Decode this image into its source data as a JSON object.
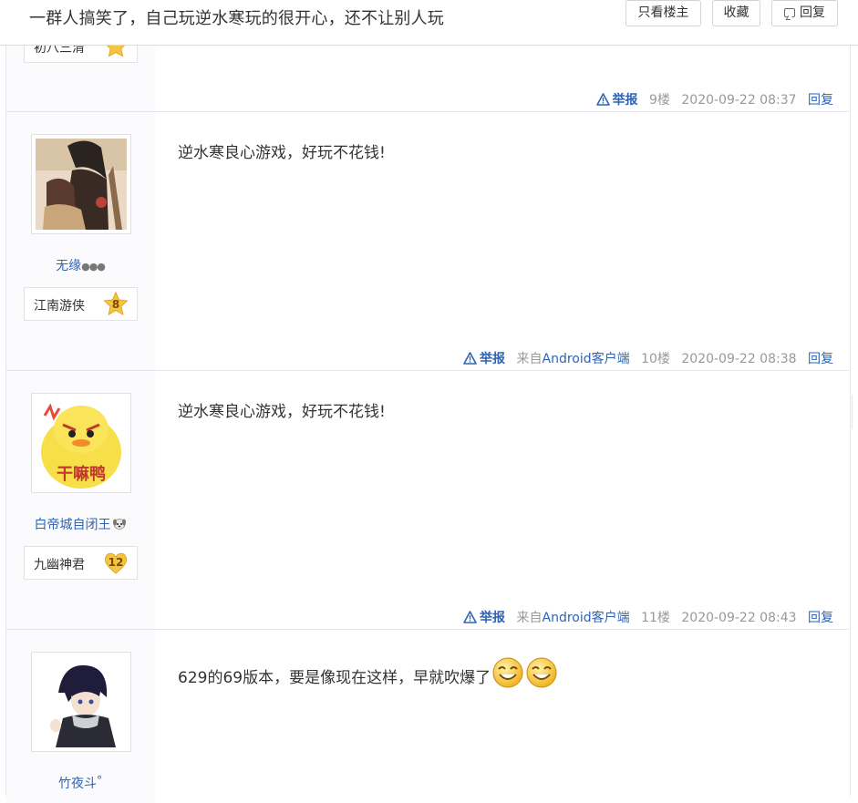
{
  "thread": {
    "title": "一群人搞笑了，自己玩逆水寒玩的很开心，还不让别人玩",
    "only_op_label": "只看楼主",
    "collect_label": "收藏",
    "reply_label": "回复"
  },
  "posts": [
    {
      "level_name": "初八三清",
      "report_label": "举报",
      "client": "",
      "floor": "9楼",
      "time": "2020-09-22 08:37",
      "reply_label": "回复"
    },
    {
      "username": "无缘",
      "username_suffix": "●●●",
      "level_name": "江南游侠",
      "level": "8",
      "content": "逆水寒良心游戏，好玩不花钱!",
      "report_label": "举报",
      "client_prefix": "来自",
      "client_name": "Android客户端",
      "floor": "10楼",
      "time": "2020-09-22 08:38",
      "reply_label": "回复"
    },
    {
      "username": "白帝城自闭王",
      "level_name": "九幽神君",
      "level": "12",
      "avatar_text": "干嘛鸭",
      "content": "逆水寒良心游戏，好玩不花钱!",
      "report_label": "举报",
      "client_prefix": "来自",
      "client_name": "Android客户端",
      "floor": "11楼",
      "time": "2020-09-22 08:43",
      "reply_label": "回复"
    },
    {
      "username": "竹夜斗",
      "username_suffix": "°",
      "content": "629的69版本，要是像现在这样，早就吹爆了"
    }
  ],
  "colors": {
    "link": "#2d64b3",
    "meta": "#999999",
    "sidebar_bg": "#fbfbfd",
    "border": "#e4e6eb",
    "badge_gold": "#f5c542"
  },
  "icons": {
    "report": "warning-triangle-icon",
    "reply": "speech-bubble-icon",
    "level": "star-badge-icon",
    "smiley": "smiley-emoji-icon"
  }
}
